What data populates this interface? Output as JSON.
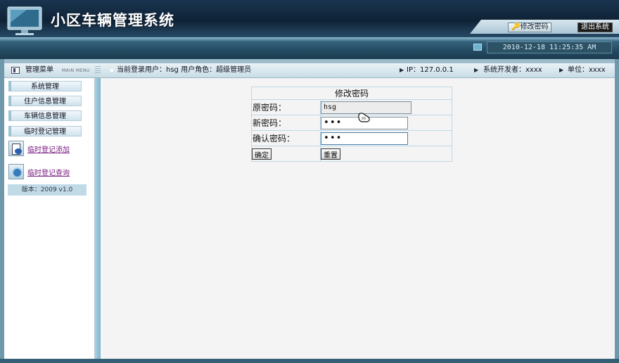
{
  "header": {
    "title": "小区车辆管理系统",
    "change_password": "修改密码",
    "logout": "退出系统",
    "datetime": "2010-12-18 11:25:35 AM"
  },
  "infobar": {
    "menu_title": "管理菜单",
    "menu_sub": "MAIN MENU",
    "current_user": "当前登录用户：hsg  用户角色：超级管理员",
    "ip": "IP：127.0.0.1",
    "developer": "系统开发者：xxxx",
    "unit": "单位：xxxx"
  },
  "sidebar": {
    "items": [
      {
        "label": "系统管理"
      },
      {
        "label": "住户信息管理"
      },
      {
        "label": "车辆信息管理"
      },
      {
        "label": "临时登记管理"
      }
    ],
    "links": [
      {
        "label": "临时登记添加",
        "icon": "document-icon"
      },
      {
        "label": "临时登记查询",
        "icon": "search-icon"
      }
    ],
    "version": "版本：2009 v1.0"
  },
  "form": {
    "caption": "修改密码",
    "old_label": "原密码：",
    "old_value": "hsg",
    "new_label": "新密码：",
    "new_value": "•••",
    "confirm_label": "确认密码：",
    "confirm_value": "•••",
    "submit": "确定",
    "reset": "重置"
  },
  "colors": {
    "header_bg": "#0f2236",
    "accent": "#7fb6cc",
    "link": "#7a1f82"
  }
}
